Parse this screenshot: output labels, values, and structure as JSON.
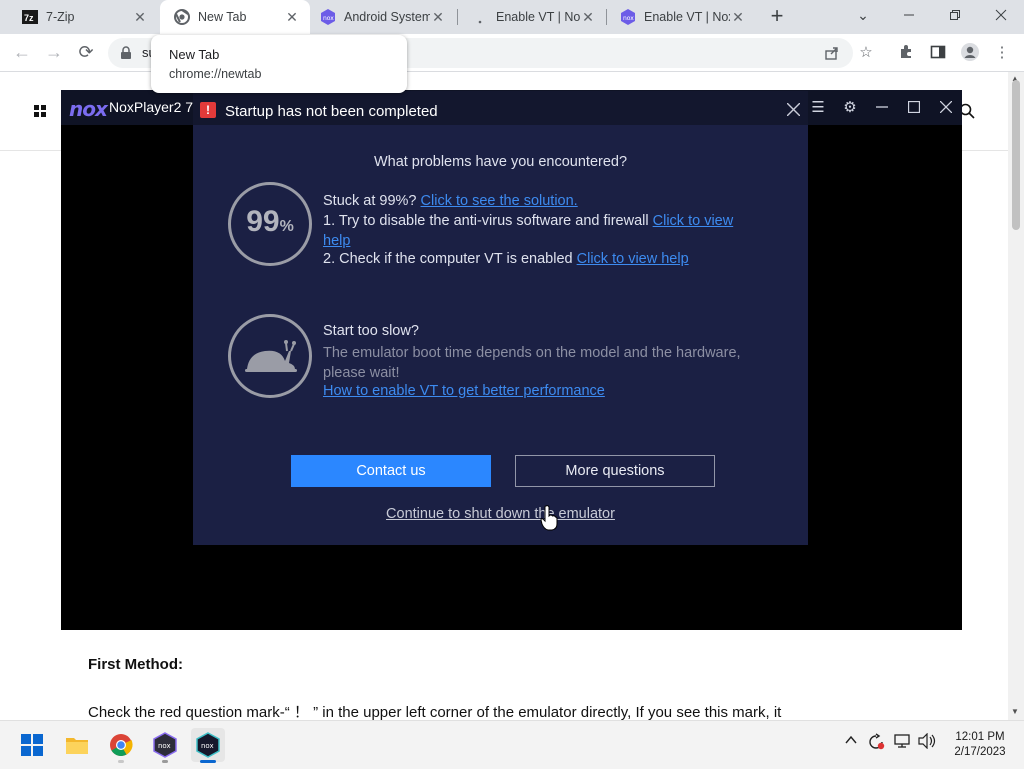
{
  "browser": {
    "tabs": [
      {
        "title": "7-Zip",
        "icon": "7zip-icon",
        "active": false
      },
      {
        "title": "New Tab",
        "icon": "chrome-icon",
        "active": true
      },
      {
        "title": "Android System",
        "icon": "nox-icon",
        "active": false
      },
      {
        "title": "Enable VT | Nox",
        "icon": "loading-icon",
        "active": false
      },
      {
        "title": "Enable VT | Nox",
        "icon": "nox-icon",
        "active": false
      }
    ],
    "new_tab_symbol": "+",
    "omnibox_text": "su",
    "hover_card": {
      "title": "New Tab",
      "url": "chrome://newtab"
    }
  },
  "webpage": {
    "section_heading": "First Method:",
    "paragraph": "Check the red question mark-“ ！ ” in the upper left corner of the emulator directly, If you see this mark, it"
  },
  "nox_window": {
    "logo_text": "nox",
    "title": "NoxPlayer2 7"
  },
  "dialog": {
    "title": "Startup has not been completed",
    "question": "What problems have you encountered?",
    "progress_percent": 99,
    "progress_number": "99",
    "progress_unit": "%",
    "stuck": {
      "text": "Stuck at 99%?",
      "solution_link": "Click to see the solution.",
      "step1_text": "1. Try to disable the anti-virus software and firewall",
      "step1_link_a": "Click to view",
      "step1_link_b": "help",
      "step2_text": "2. Check if the computer VT is enabled",
      "step2_link": "Click to view help"
    },
    "slow": {
      "text": "Start too slow?",
      "desc_line1": "The emulator boot time depends on the model and the hardware,",
      "desc_line2": "please wait!",
      "link": "How to enable VT to get better performance"
    },
    "contact_button": "Contact us",
    "more_button": "More questions",
    "continue_link": "Continue to shut down the emulator"
  },
  "taskbar": {
    "apps": [
      "start-icon",
      "file-explorer-icon",
      "chrome-icon",
      "nox-multi-icon",
      "nox-icon"
    ],
    "time": "12:01 PM",
    "date": "2/17/2023"
  },
  "colors": {
    "dialog_bg": "#1b2044",
    "dialog_header_bg": "#13172e",
    "link_blue": "#3d8bf0",
    "primary_button": "#2b87ff",
    "warning_red": "#e23a3a",
    "nox_purple": "#7b6cf0"
  }
}
